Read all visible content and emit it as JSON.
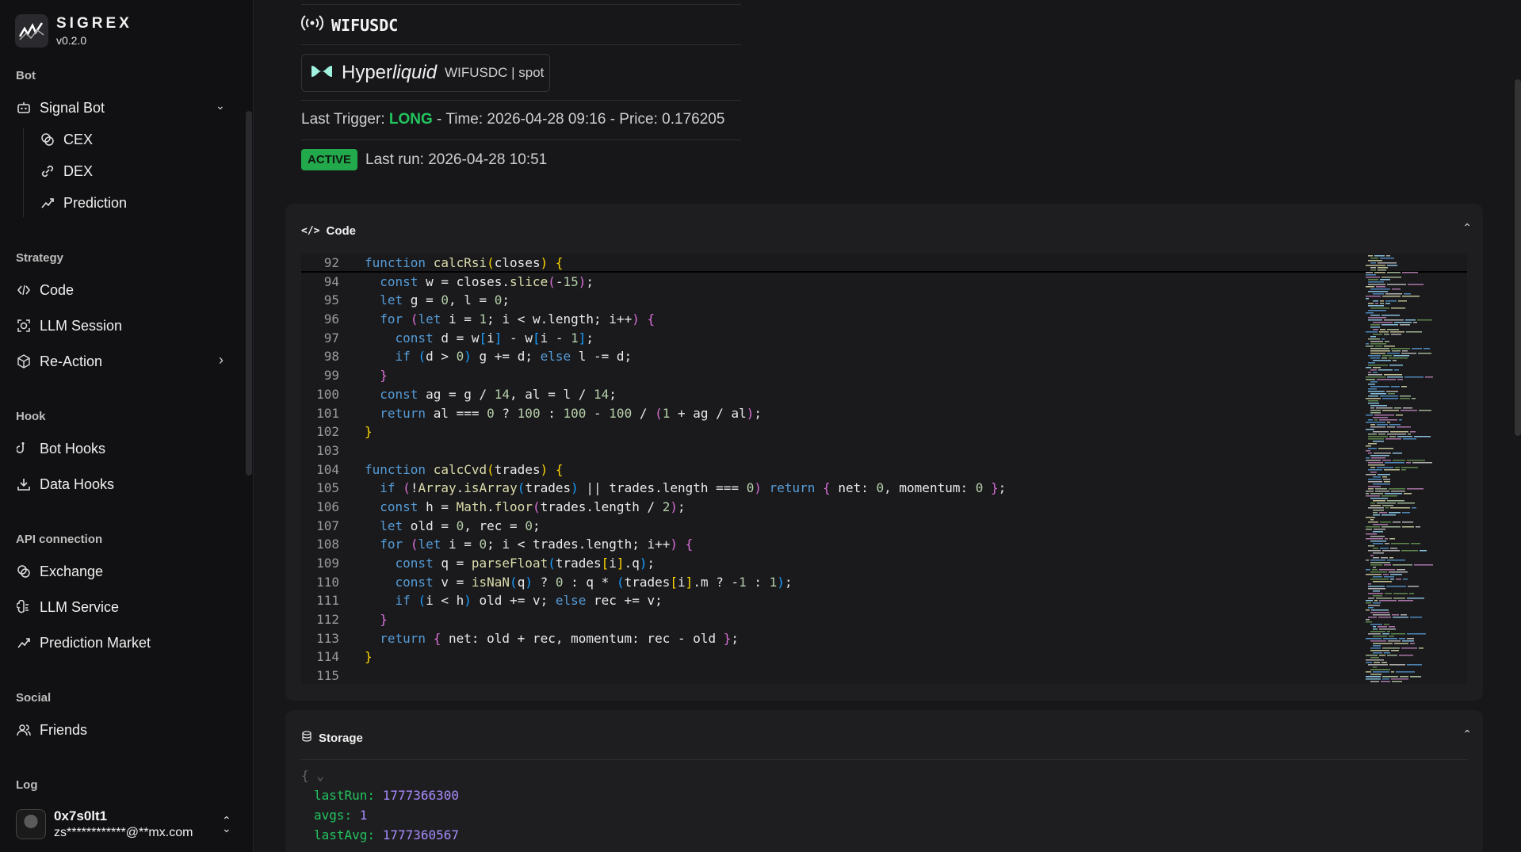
{
  "app": {
    "name": "SIGREX",
    "version": "v0.2.0"
  },
  "sidebar": {
    "sections": {
      "bot": "Bot",
      "strategy": "Strategy",
      "hook": "Hook",
      "api": "API connection",
      "social": "Social",
      "log": "Log"
    },
    "items": {
      "signal_bot": "Signal Bot",
      "cex": "CEX",
      "dex": "DEX",
      "prediction": "Prediction",
      "code": "Code",
      "llm_session": "LLM Session",
      "reaction": "Re-Action",
      "bot_hooks": "Bot Hooks",
      "data_hooks": "Data Hooks",
      "exchange": "Exchange",
      "llm_service": "LLM Service",
      "prediction_market": "Prediction Market",
      "friends": "Friends"
    },
    "user": {
      "name": "0x7s0lt1",
      "email": "zs************@**mx.com"
    }
  },
  "main": {
    "title": "WIFUSDC",
    "exchange": {
      "name_prefix": "Hyper",
      "name_italic": "liquid",
      "meta": "WIFUSDC | spot"
    },
    "trigger": {
      "prefix": "Last Trigger: ",
      "side": "LONG",
      "suffix": " - Time: 2026-04-28 09:16 - Price: 0.176205"
    },
    "status": {
      "badge": "ACTIVE",
      "last_run": "Last run: 2026-04-28 10:51"
    },
    "code_panel": {
      "title": "Code"
    },
    "storage_panel": {
      "title": "Storage",
      "entries": [
        {
          "key": "lastRun",
          "value": "1777366300"
        },
        {
          "key": "avgs",
          "value": "1"
        },
        {
          "key": "lastAvg",
          "value": "1777360567"
        }
      ]
    }
  },
  "code_lines": [
    {
      "n": "92",
      "html": "<span class='k'>function</span> <span class='f'>calcRsi</span><span class='b1'>(</span>closes<span class='b1'>)</span> <span class='b1'>{</span>"
    },
    {
      "n": "94",
      "html": "  <span class='k'>const</span> w = closes.<span class='f'>slice</span><span class='b2'>(</span>-<span class='n'>15</span><span class='b2'>)</span>;"
    },
    {
      "n": "95",
      "html": "  <span class='k'>let</span> g = <span class='n'>0</span>, l = <span class='n'>0</span>;"
    },
    {
      "n": "96",
      "html": "  <span class='k'>for</span> <span class='b2'>(</span><span class='k'>let</span> i = <span class='n'>1</span>; i &lt; w.length; i++<span class='b2'>)</span> <span class='b2'>{</span>"
    },
    {
      "n": "97",
      "html": "    <span class='k'>const</span> d = w<span class='b3'>[</span>i<span class='b3'>]</span> - w<span class='b3'>[</span>i - <span class='n'>1</span><span class='b3'>]</span>;"
    },
    {
      "n": "98",
      "html": "    <span class='k'>if</span> <span class='b3'>(</span>d &gt; <span class='n'>0</span><span class='b3'>)</span> g += d; <span class='k'>else</span> l -= d;"
    },
    {
      "n": "99",
      "html": "  <span class='b2'>}</span>"
    },
    {
      "n": "100",
      "html": "  <span class='k'>const</span> ag = g / <span class='n'>14</span>, al = l / <span class='n'>14</span>;"
    },
    {
      "n": "101",
      "html": "  <span class='k'>return</span> al === <span class='n'>0</span> ? <span class='n'>100</span> : <span class='n'>100</span> - <span class='n'>100</span> / <span class='b2'>(</span><span class='n'>1</span> + ag / al<span class='b2'>)</span>;"
    },
    {
      "n": "102",
      "html": "<span class='b1'>}</span>"
    },
    {
      "n": "103",
      "html": ""
    },
    {
      "n": "104",
      "html": "<span class='k'>function</span> <span class='f'>calcCvd</span><span class='b1'>(</span>trades<span class='b1'>)</span> <span class='b1'>{</span>"
    },
    {
      "n": "105",
      "html": "  <span class='k'>if</span> <span class='b2'>(</span>!<span class='f'>Array</span>.<span class='f'>isArray</span><span class='b3'>(</span>trades<span class='b3'>)</span> || trades.length === <span class='n'>0</span><span class='b2'>)</span> <span class='k'>return</span> <span class='b2'>{</span> net: <span class='n'>0</span>, momentum: <span class='n'>0</span> <span class='b2'>}</span>;"
    },
    {
      "n": "106",
      "html": "  <span class='k'>const</span> h = <span class='f'>Math</span>.<span class='f'>floor</span><span class='b2'>(</span>trades.length / <span class='n'>2</span><span class='b2'>)</span>;"
    },
    {
      "n": "107",
      "html": "  <span class='k'>let</span> old = <span class='n'>0</span>, rec = <span class='n'>0</span>;"
    },
    {
      "n": "108",
      "html": "  <span class='k'>for</span> <span class='b2'>(</span><span class='k'>let</span> i = <span class='n'>0</span>; i &lt; trades.length; i++<span class='b2'>)</span> <span class='b2'>{</span>"
    },
    {
      "n": "109",
      "html": "    <span class='k'>const</span> q = <span class='f'>parseFloat</span><span class='b3'>(</span>trades<span class='b1'>[</span>i<span class='b1'>]</span>.q<span class='b3'>)</span>;"
    },
    {
      "n": "110",
      "html": "    <span class='k'>const</span> v = <span class='f'>isNaN</span><span class='b3'>(</span>q<span class='b3'>)</span> ? <span class='n'>0</span> : q * <span class='b3'>(</span>trades<span class='b1'>[</span>i<span class='b1'>]</span>.m ? -<span class='n'>1</span> : <span class='n'>1</span><span class='b3'>)</span>;"
    },
    {
      "n": "111",
      "html": "    <span class='k'>if</span> <span class='b3'>(</span>i &lt; h<span class='b3'>)</span> old += v; <span class='k'>else</span> rec += v;"
    },
    {
      "n": "112",
      "html": "  <span class='b2'>}</span>"
    },
    {
      "n": "113",
      "html": "  <span class='k'>return</span> <span class='b2'>{</span> net: old + rec, momentum: rec - old <span class='b2'>}</span>;"
    },
    {
      "n": "114",
      "html": "<span class='b1'>}</span>"
    },
    {
      "n": "115",
      "html": ""
    }
  ]
}
